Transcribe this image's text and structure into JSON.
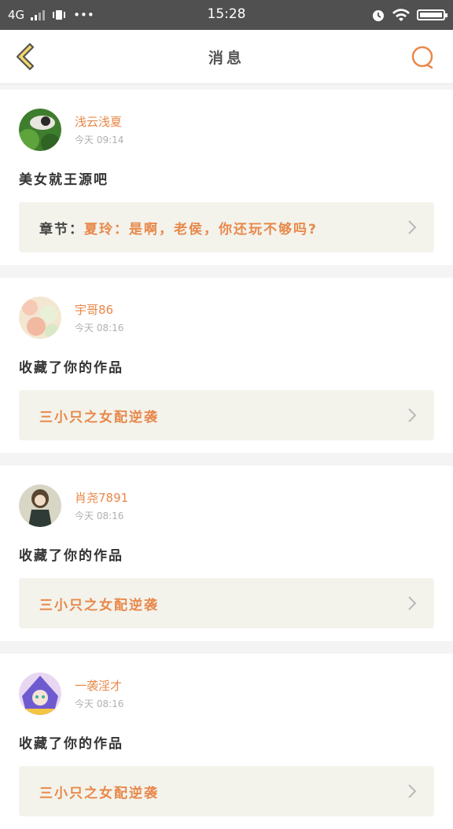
{
  "status_bar": {
    "network": "4G",
    "time": "15:28"
  },
  "header": {
    "title": "消息"
  },
  "colors": {
    "accent": "#e8884a",
    "back_arrow_fill": "#f2d866",
    "quote_bg": "#f3f3ec"
  },
  "messages": [
    {
      "username": "浅云浅夏",
      "time": "今天 09:14",
      "text": "美女就王源吧",
      "quote_label": "章节：",
      "quote_text": "夏玲：是啊，老侯，你还玩不够吗?"
    },
    {
      "username": "宇哥86",
      "time": "今天 08:16",
      "text": "收藏了你的作品",
      "quote_label": "",
      "quote_text": "三小只之女配逆袭"
    },
    {
      "username": "肖尧7891",
      "time": "今天 08:16",
      "text": "收藏了你的作品",
      "quote_label": "",
      "quote_text": "三小只之女配逆袭"
    },
    {
      "username": "一袭淫才",
      "time": "今天 08:16",
      "text": "收藏了你的作品",
      "quote_label": "",
      "quote_text": "三小只之女配逆袭"
    }
  ]
}
